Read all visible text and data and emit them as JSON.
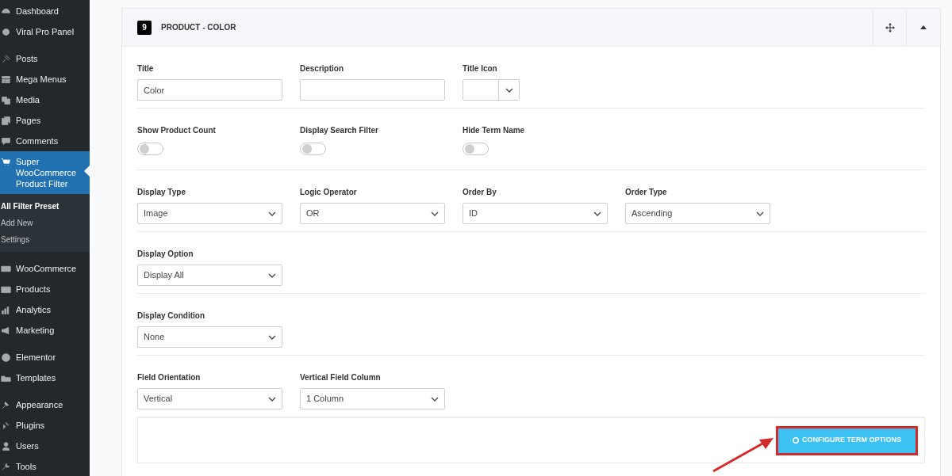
{
  "sidebar": {
    "menu_groups": [
      [
        {
          "label": "Dashboard",
          "selected": false
        },
        {
          "label": "Viral Pro Panel",
          "selected": false
        }
      ],
      [
        {
          "label": "Posts",
          "selected": false
        },
        {
          "label": "Mega Menus",
          "selected": false
        },
        {
          "label": "Media",
          "selected": false
        },
        {
          "label": "Pages",
          "selected": false
        },
        {
          "label": "Comments",
          "selected": false
        },
        {
          "label": "Super WooCommerce Product Filter",
          "selected": true,
          "submenu": [
            {
              "label": "All Filter Preset",
              "selected": true
            },
            {
              "label": "Add New",
              "selected": false
            },
            {
              "label": "Settings",
              "selected": false
            }
          ]
        }
      ],
      [
        {
          "label": "WooCommerce",
          "selected": false
        },
        {
          "label": "Products",
          "selected": false
        },
        {
          "label": "Analytics",
          "selected": false
        },
        {
          "label": "Marketing",
          "selected": false
        }
      ],
      [
        {
          "label": "Elementor",
          "selected": false
        },
        {
          "label": "Templates",
          "selected": false
        }
      ],
      [
        {
          "label": "Appearance",
          "selected": false
        },
        {
          "label": "Plugins",
          "selected": false
        },
        {
          "label": "Users",
          "selected": false
        },
        {
          "label": "Tools",
          "selected": false
        }
      ]
    ]
  },
  "panel": {
    "number": "9",
    "title": "PRODUCT - COLOR",
    "expanded": true,
    "rows": [
      [
        {
          "kind": "text",
          "label": "Title",
          "value": "Color"
        },
        {
          "kind": "text",
          "label": "Description"
        },
        {
          "kind": "icon_select",
          "label": "Title Icon"
        }
      ],
      [
        {
          "kind": "toggle",
          "label": "Show Product Count",
          "on": false
        },
        {
          "kind": "toggle",
          "label": "Display Search Filter",
          "on": false
        },
        {
          "kind": "toggle",
          "label": "Hide Term Name",
          "on": false
        }
      ],
      [
        {
          "kind": "select",
          "label": "Display Type",
          "value": "Image"
        },
        {
          "kind": "select",
          "label": "Logic Operator",
          "value": "OR"
        },
        {
          "kind": "select",
          "label": "Order By",
          "value": "ID"
        },
        {
          "kind": "select",
          "label": "Order Type",
          "value": "Ascending"
        }
      ],
      [
        {
          "kind": "select",
          "label": "Display Option",
          "value": "Display All"
        }
      ],
      [
        {
          "kind": "select",
          "label": "Display Condition",
          "value": "None"
        }
      ],
      [
        {
          "kind": "select",
          "label": "Field Orientation",
          "value": "Vertical"
        },
        {
          "kind": "select",
          "label": "Vertical Field Column",
          "value": "1 Column"
        }
      ]
    ],
    "configure_button": "CONFIGURE TERM OPTIONS"
  }
}
